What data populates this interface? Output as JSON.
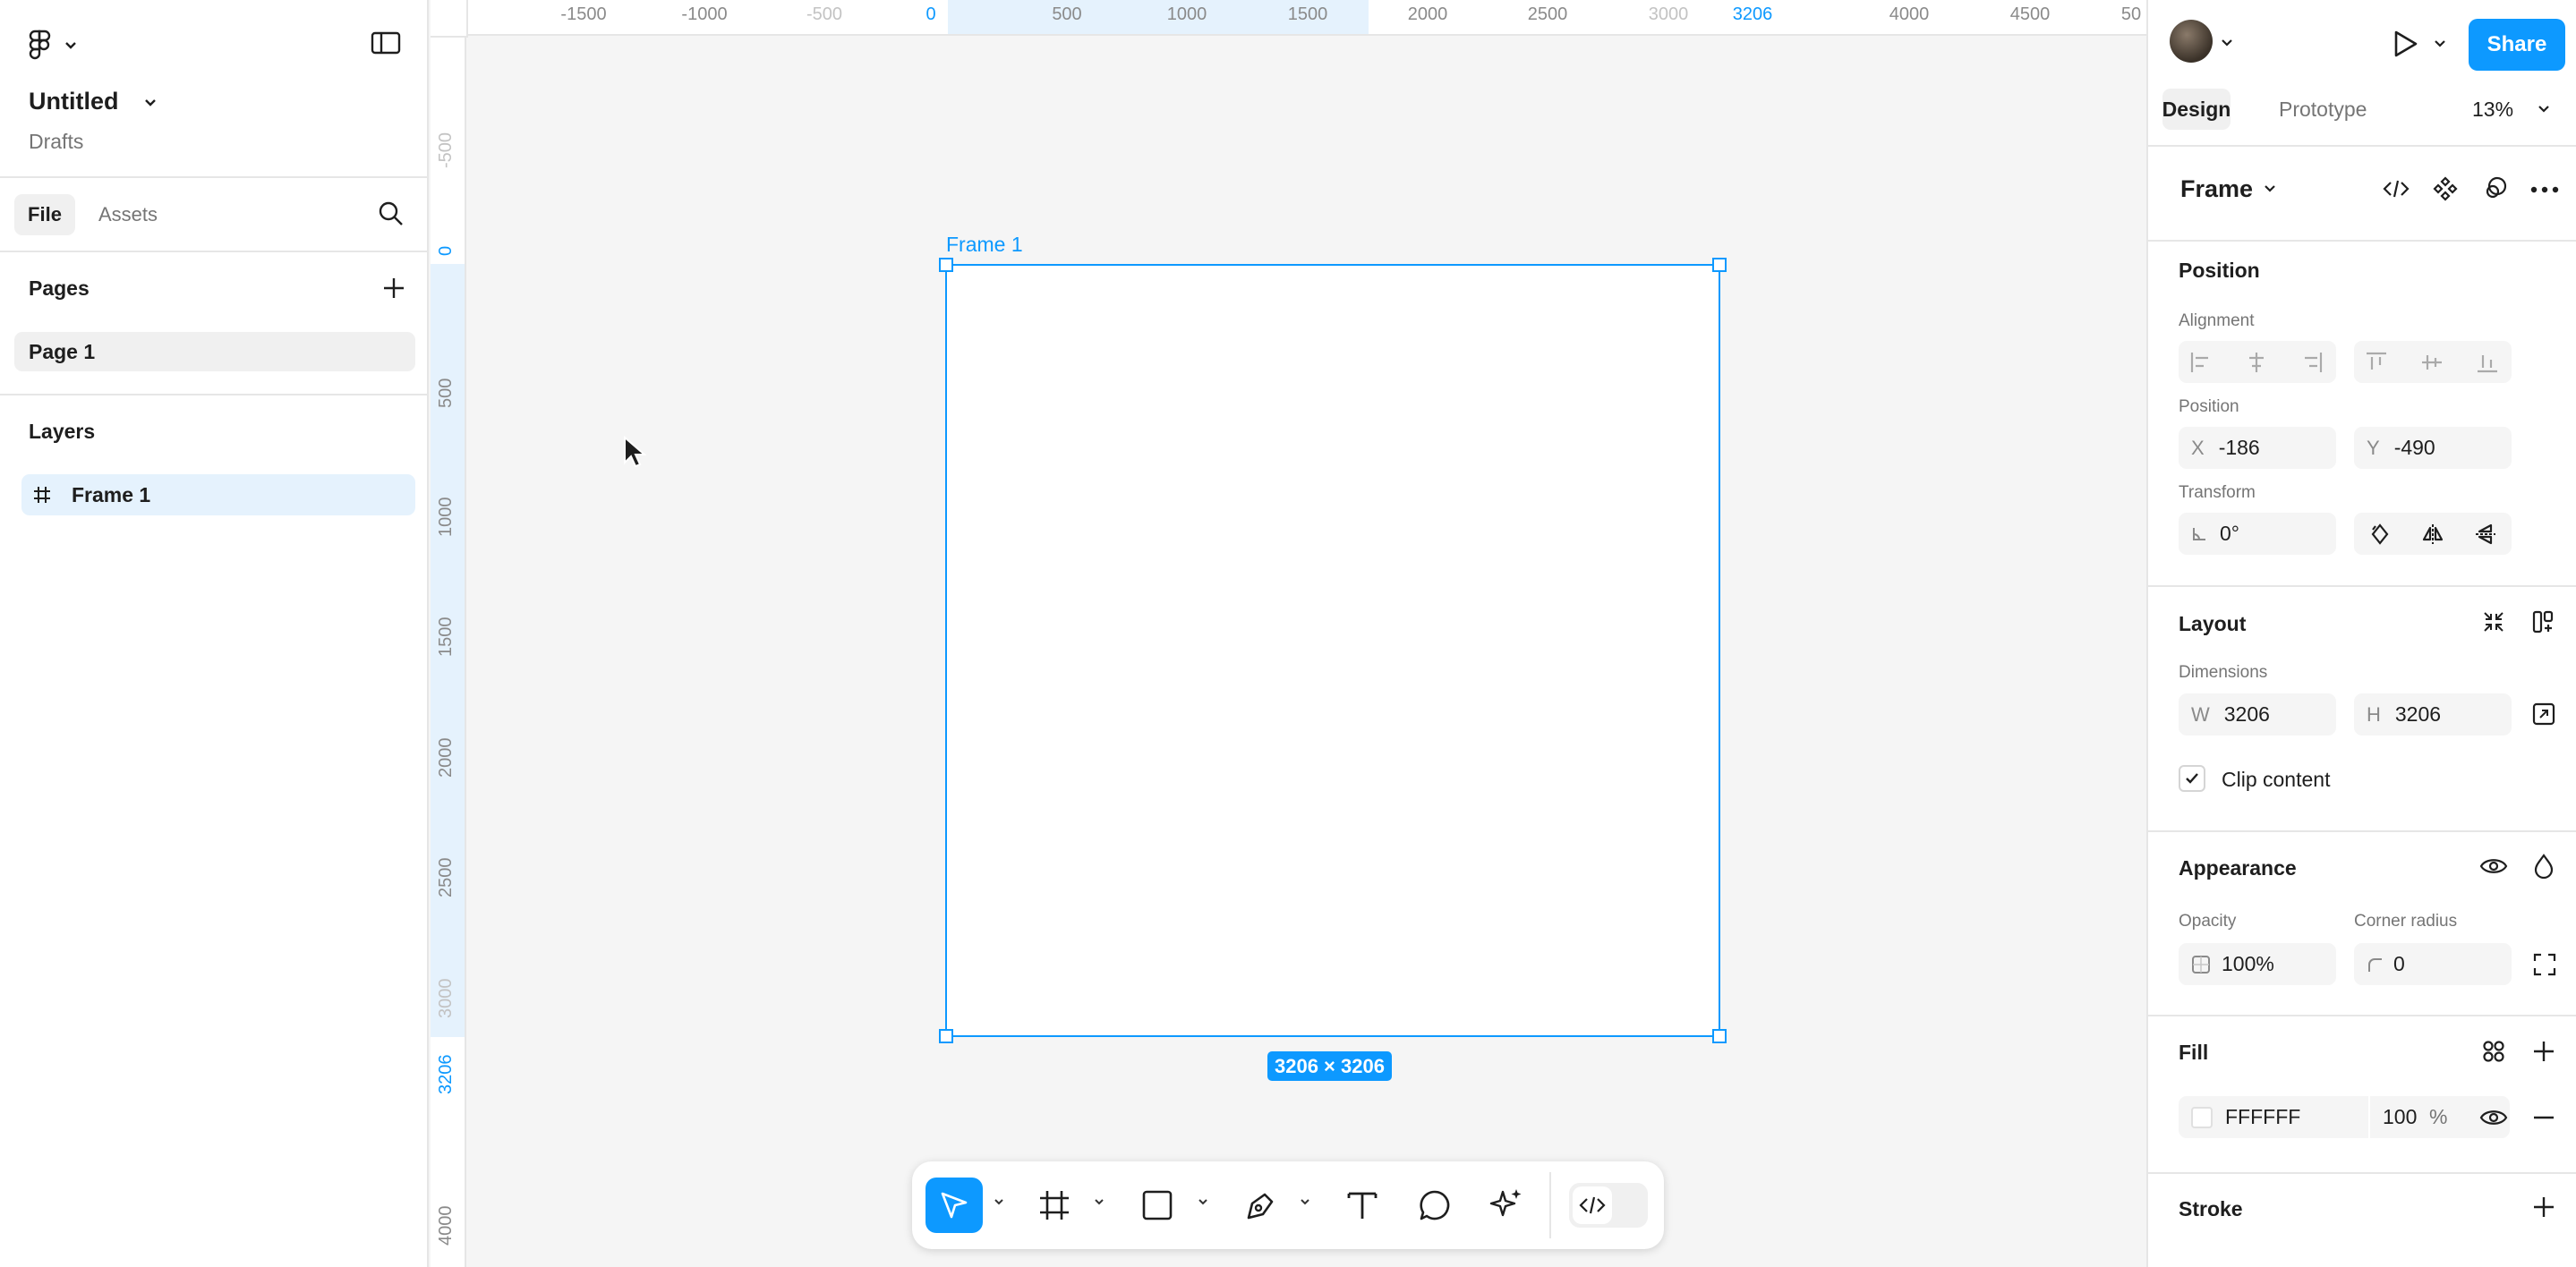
{
  "file": {
    "title": "Untitled",
    "location": "Drafts"
  },
  "left_tabs": {
    "file": "File",
    "assets": "Assets"
  },
  "pages": {
    "heading": "Pages",
    "items": [
      {
        "label": "Page 1"
      }
    ]
  },
  "layers": {
    "heading": "Layers",
    "items": [
      {
        "label": "Frame 1"
      }
    ]
  },
  "ruler_top": [
    "-1500",
    "-1000",
    "-500",
    "0",
    "500",
    "1000",
    "1500",
    "2000",
    "2500",
    "3000",
    "3206",
    "4000",
    "4500",
    "50"
  ],
  "ruler_left": [
    "-500",
    "0",
    "500",
    "1000",
    "1500",
    "2000",
    "2500",
    "3000",
    "3206",
    "4000"
  ],
  "canvas": {
    "frame_label": "Frame 1",
    "size_badge": "3206 × 3206"
  },
  "right_tabs": {
    "design": "Design",
    "prototype": "Prototype",
    "zoom": "13%"
  },
  "share_label": "Share",
  "selection": {
    "type": "Frame"
  },
  "position": {
    "heading": "Position",
    "alignment_label": "Alignment",
    "position_label": "Position",
    "x_prefix": "X",
    "x": "-186",
    "y_prefix": "Y",
    "y": "-490",
    "transform_label": "Transform",
    "rotation": "0°"
  },
  "layout": {
    "heading": "Layout",
    "dimensions_label": "Dimensions",
    "w_prefix": "W",
    "w": "3206",
    "h_prefix": "H",
    "h": "3206",
    "clip_content": "Clip content"
  },
  "appearance": {
    "heading": "Appearance",
    "opacity_label": "Opacity",
    "opacity": "100%",
    "radius_label": "Corner radius",
    "radius": "0"
  },
  "fill": {
    "heading": "Fill",
    "hex": "FFFFFF",
    "opacity": "100",
    "unit": "%",
    "swatch": "#FFFFFF"
  },
  "stroke": {
    "heading": "Stroke"
  },
  "colors": {
    "accent": "#0D99FF"
  }
}
